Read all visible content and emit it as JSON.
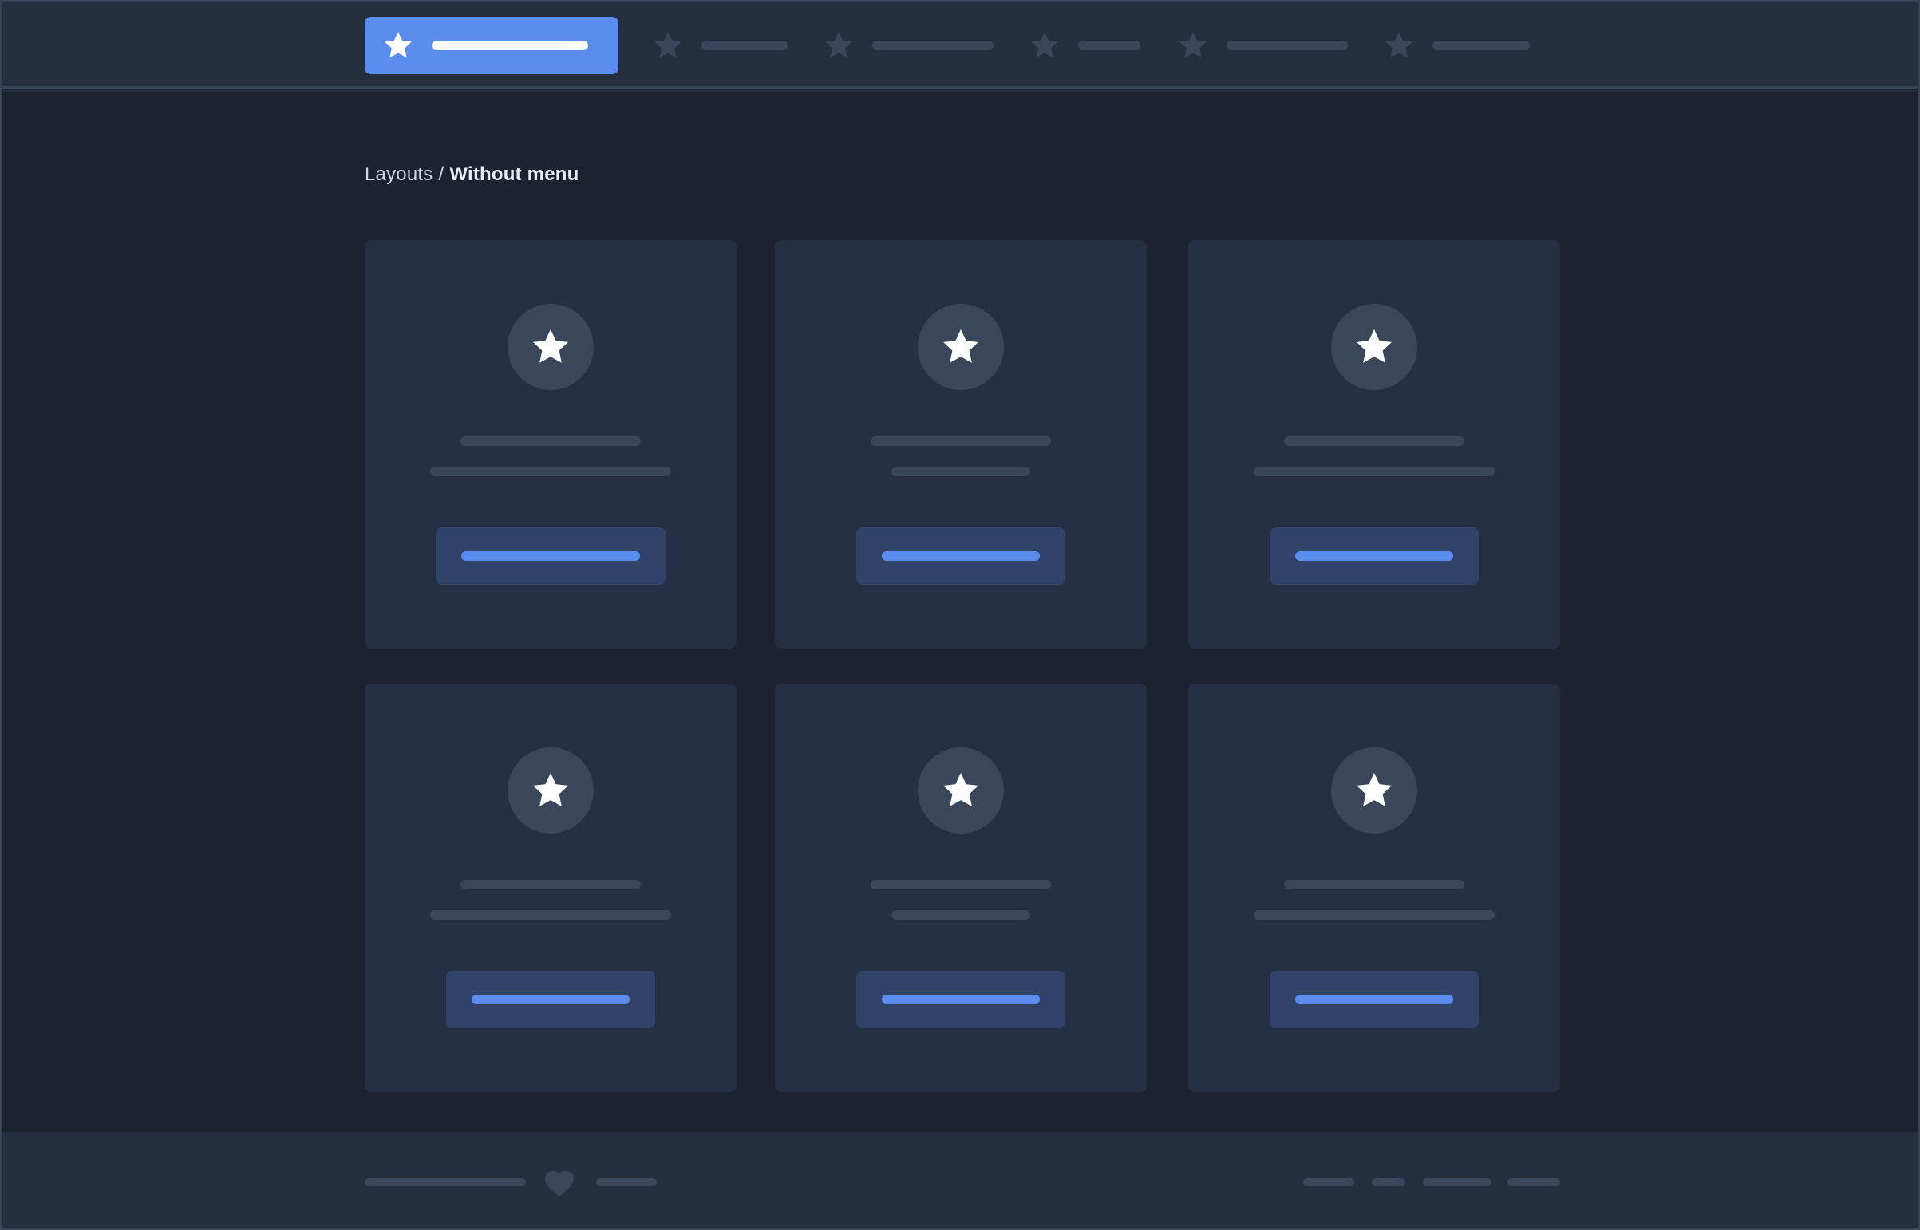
{
  "header": {
    "nav_items": [
      {
        "name": "nav-item-1",
        "icon": "star-icon",
        "active": true
      },
      {
        "name": "nav-item-2",
        "icon": "star-icon",
        "active": false
      },
      {
        "name": "nav-item-3",
        "icon": "star-icon",
        "active": false
      },
      {
        "name": "nav-item-4",
        "icon": "star-icon",
        "active": false
      },
      {
        "name": "nav-item-5",
        "icon": "star-icon",
        "active": false
      },
      {
        "name": "nav-item-6",
        "icon": "star-icon",
        "active": false
      }
    ]
  },
  "breadcrumb": {
    "parent": "Layouts",
    "separator": "/",
    "current": "Without menu"
  },
  "cards": [
    {
      "icon": "star-icon"
    },
    {
      "icon": "star-icon"
    },
    {
      "icon": "star-icon"
    },
    {
      "icon": "star-icon"
    },
    {
      "icon": "star-icon"
    },
    {
      "icon": "star-icon"
    }
  ],
  "footer": {
    "icon": "heart-icon"
  },
  "colors": {
    "background": "#1c2230",
    "surface": "#263044",
    "accent": "#5b8def",
    "placeholder": "#3a4659",
    "button_bg": "#32436a"
  }
}
